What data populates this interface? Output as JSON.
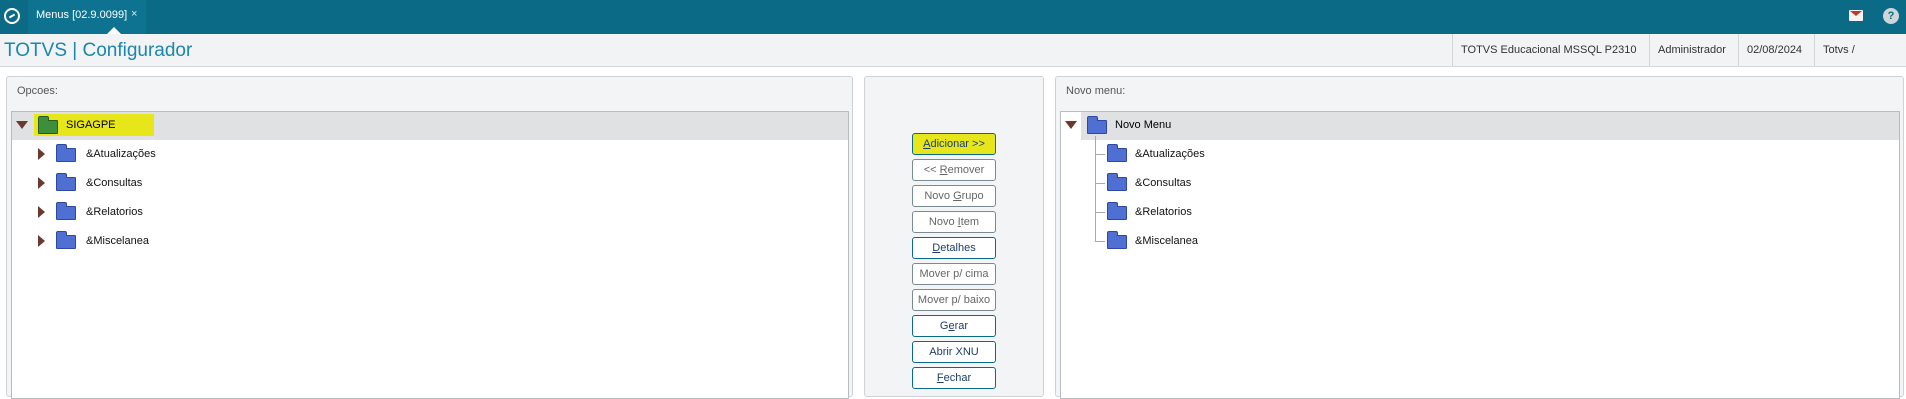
{
  "topbar": {
    "tab_label": "Menus [02.9.0099]",
    "tab_close": "×",
    "logo_icon": "totvs-logo-icon",
    "mail_icon": "mail-icon",
    "help_icon": "help-icon",
    "help_glyph": "?"
  },
  "header": {
    "title": "TOTVS | Configurador",
    "env": "TOTVS Educacional MSSQL P2310",
    "user": "Administrador",
    "date": "02/08/2024",
    "branch": "Totvs / Londrina"
  },
  "left": {
    "title": "Opcoes:",
    "root": "SIGAGPE",
    "items": [
      {
        "label": "&Atualizações"
      },
      {
        "label": "&Consultas"
      },
      {
        "label": "&Relatorios"
      },
      {
        "label": "&Miscelanea"
      }
    ]
  },
  "buttons": {
    "add": {
      "pre": "",
      "acc": "A",
      "post": "dicionar >>"
    },
    "remove": {
      "pre": "<< ",
      "acc": "R",
      "post": "emover"
    },
    "new_group": {
      "pre": "Novo ",
      "acc": "G",
      "post": "rupo"
    },
    "new_item": {
      "pre": "Novo ",
      "acc": "I",
      "post": "tem"
    },
    "details": {
      "pre": "",
      "acc": "D",
      "post": "etalhes"
    },
    "move_up": {
      "pre": "Mover p/ cima",
      "acc": "",
      "post": ""
    },
    "move_down": {
      "pre": "Mover p/ baixo",
      "acc": "",
      "post": ""
    },
    "generate": {
      "pre": "G",
      "acc": "e",
      "post": "rar"
    },
    "open_xnu": {
      "pre": "Abrir XNU",
      "acc": "",
      "post": ""
    },
    "close": {
      "pre": "",
      "acc": "F",
      "post": "echar"
    }
  },
  "right": {
    "title": "Novo menu:",
    "root": "Novo Menu",
    "items": [
      {
        "label": "&Atualizações"
      },
      {
        "label": "&Consultas"
      },
      {
        "label": "&Relatorios"
      },
      {
        "label": "&Miscelanea"
      }
    ]
  },
  "colors": {
    "topbar": "#0b6b86",
    "accent": "#1b87ad",
    "highlight": "#e6e61a",
    "folder": "#4f6fd3"
  }
}
